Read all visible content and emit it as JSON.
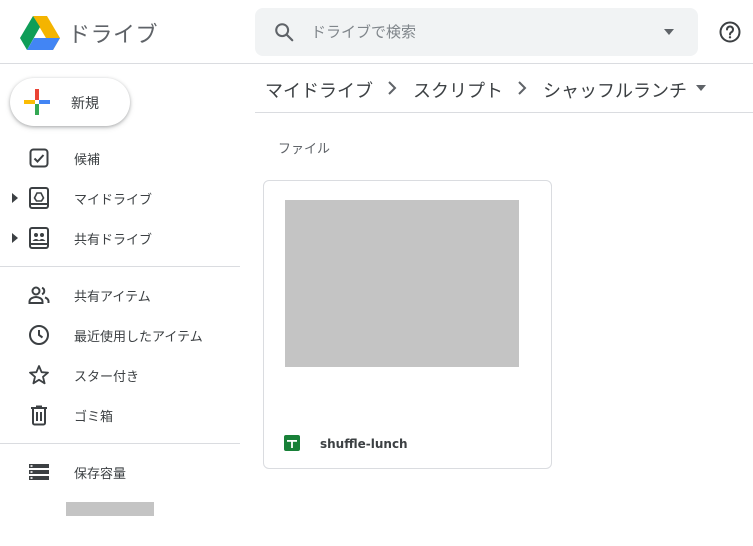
{
  "header": {
    "app_name": "ドライブ",
    "search_placeholder": "ドライブで検索"
  },
  "sidebar": {
    "new_label": "新規",
    "items": [
      {
        "label": "候補"
      },
      {
        "label": "マイドライブ"
      },
      {
        "label": "共有ドライブ"
      },
      {
        "label": "共有アイテム"
      },
      {
        "label": "最近使用したアイテム"
      },
      {
        "label": "スター付き"
      },
      {
        "label": "ゴミ箱"
      },
      {
        "label": "保存容量"
      }
    ]
  },
  "breadcrumb": [
    "マイドライブ",
    "スクリプト",
    "シャッフルランチ"
  ],
  "main": {
    "section_title": "ファイル",
    "files": [
      {
        "name": "shuffle-lunch",
        "type_icon": "google-sheets-icon"
      }
    ]
  },
  "colors": {
    "drive_green": "#0f9d58",
    "drive_yellow": "#f4b400",
    "drive_blue": "#4285f4",
    "sheets_green": "#188038",
    "search_bg": "#f1f3f4",
    "divider": "#dadce0"
  }
}
